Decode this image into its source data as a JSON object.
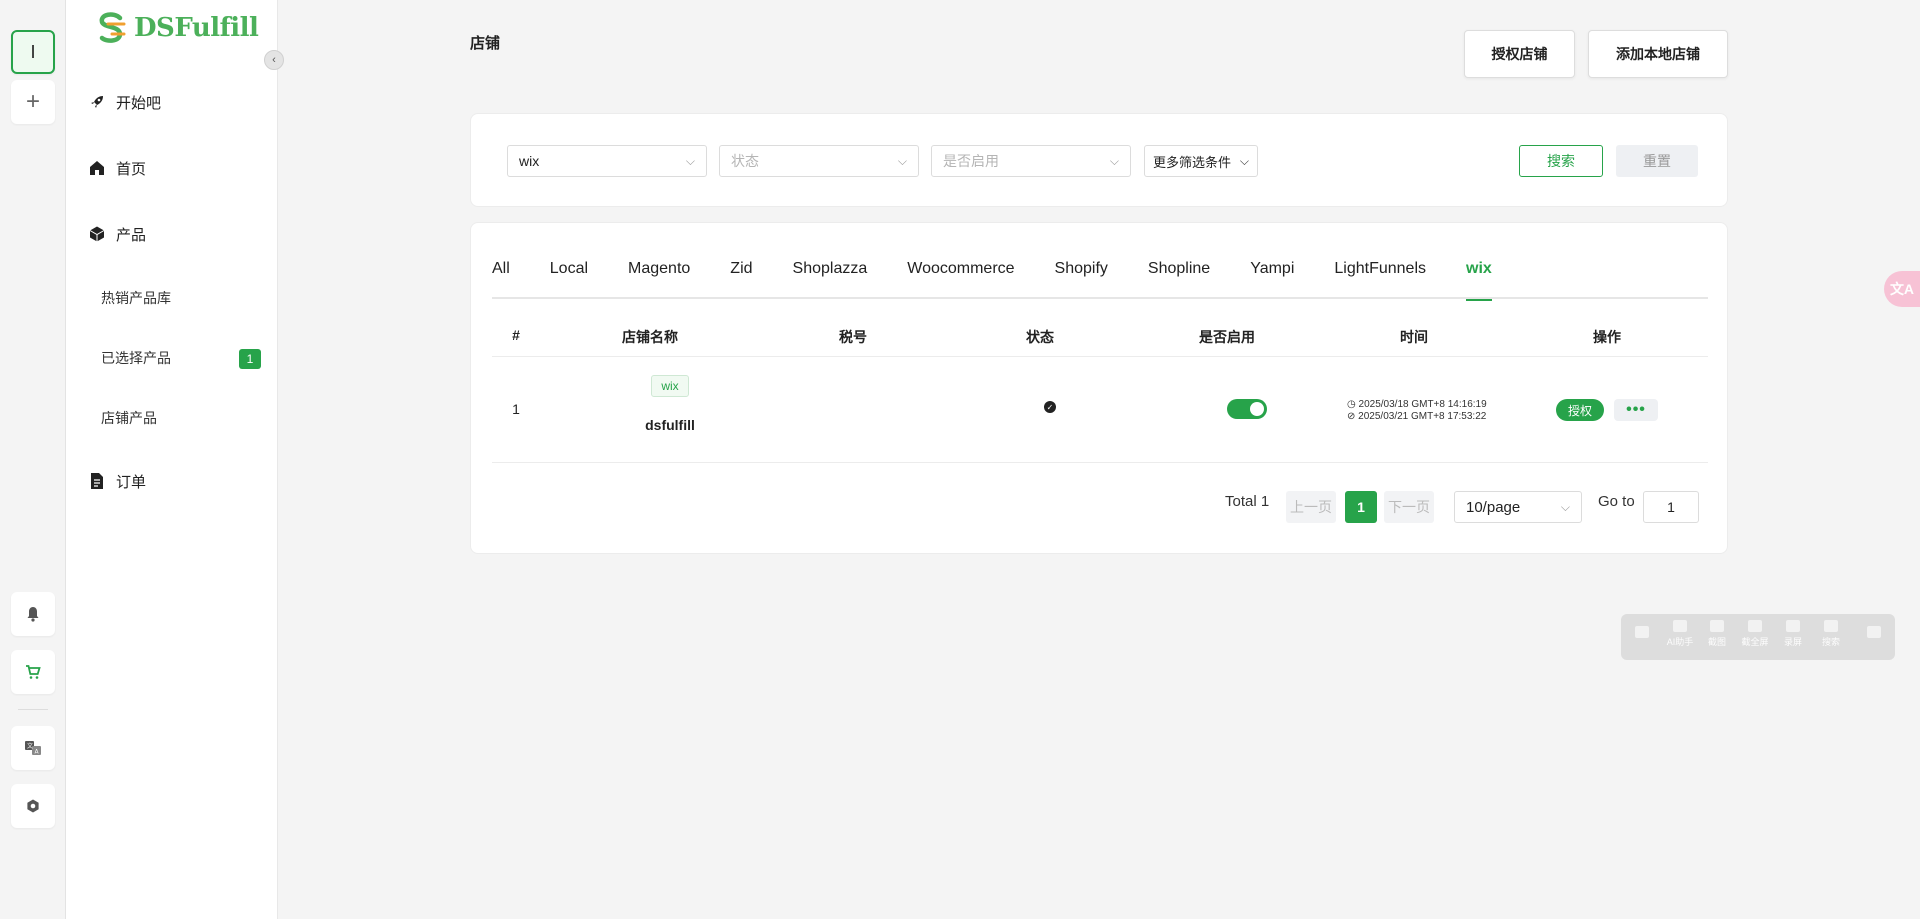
{
  "rail": {
    "active_label": "I",
    "add_label": "+"
  },
  "sidebar": {
    "logo_text": "DSFulfill",
    "items": [
      {
        "label": "开始吧",
        "icon": "rocket-icon"
      },
      {
        "label": "首页",
        "icon": "home-icon"
      },
      {
        "label": "产品",
        "icon": "box-icon"
      },
      {
        "label": "订单",
        "icon": "document-icon"
      }
    ],
    "sub_items": [
      {
        "label": "热销产品库"
      },
      {
        "label": "已选择产品",
        "badge": "1"
      },
      {
        "label": "店铺产品"
      }
    ]
  },
  "header": {
    "title": "店铺",
    "authorize_store_label": "授权店铺",
    "add_local_store_label": "添加本地店铺"
  },
  "filters": {
    "platform_value": "wix",
    "status_placeholder": "状态",
    "enabled_placeholder": "是否启用",
    "more_label": "更多筛选条件",
    "search_label": "搜索",
    "reset_label": "重置"
  },
  "tabs": [
    {
      "label": "All"
    },
    {
      "label": "Local"
    },
    {
      "label": "Magento"
    },
    {
      "label": "Zid"
    },
    {
      "label": "Shoplazza"
    },
    {
      "label": "Woocommerce"
    },
    {
      "label": "Shopify"
    },
    {
      "label": "Shopline"
    },
    {
      "label": "Yampi"
    },
    {
      "label": "LightFunnels"
    },
    {
      "label": "wix",
      "active": true
    }
  ],
  "table": {
    "headers": [
      "#",
      "店铺名称",
      "税号",
      "状态",
      "是否启用",
      "时间",
      "操作"
    ],
    "rows": [
      {
        "index": "1",
        "platform_tag": "wix",
        "name": "dsfulfill",
        "tax_no": "",
        "enabled": true,
        "time_created": "2025/03/18 GMT+8 14:16:19",
        "time_updated": "2025/03/21 GMT+8 17:53:22",
        "auth_label": "授权",
        "more_label": "•••"
      }
    ]
  },
  "pagination": {
    "total_label": "Total 1",
    "prev_label": "上一页",
    "current_page": "1",
    "next_label": "下一页",
    "page_size": "10/page",
    "goto_label": "Go to",
    "goto_value": "1"
  },
  "float_toolbar": {
    "items": [
      "AI助手",
      "截图",
      "截全屏",
      "录屏",
      "搜索"
    ]
  },
  "colors": {
    "accent": "#27a34a",
    "brand_logo": "#4cb05a",
    "translate_fab": "#f7c2d5"
  }
}
